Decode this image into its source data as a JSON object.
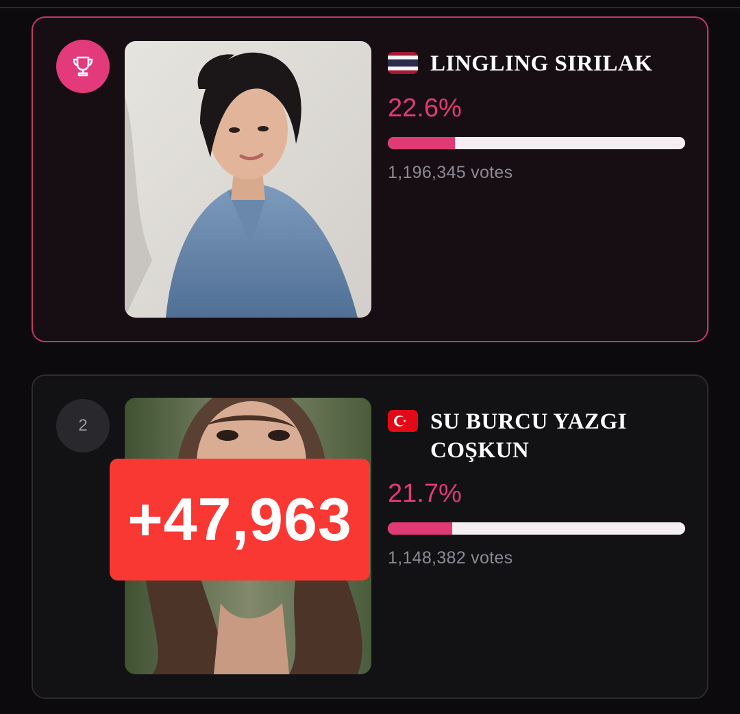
{
  "colors": {
    "accent": "#e23a72",
    "first_card_border": "#c23a63",
    "gain_badge": "#fa3833"
  },
  "contestants": [
    {
      "rank_icon": "trophy-icon",
      "flag": "thailand-flag",
      "name": "LINGLING SIRILAK",
      "percent_label": "22.6%",
      "share": 0.226,
      "votes": "1,196,345 votes"
    },
    {
      "rank": "2",
      "flag": "turkey-flag",
      "name": "SU BURCU YAZGI COŞKUN",
      "percent_label": "21.7%",
      "share": 0.217,
      "votes": "1,148,382 votes"
    }
  ],
  "vote_gain": "+47,963"
}
